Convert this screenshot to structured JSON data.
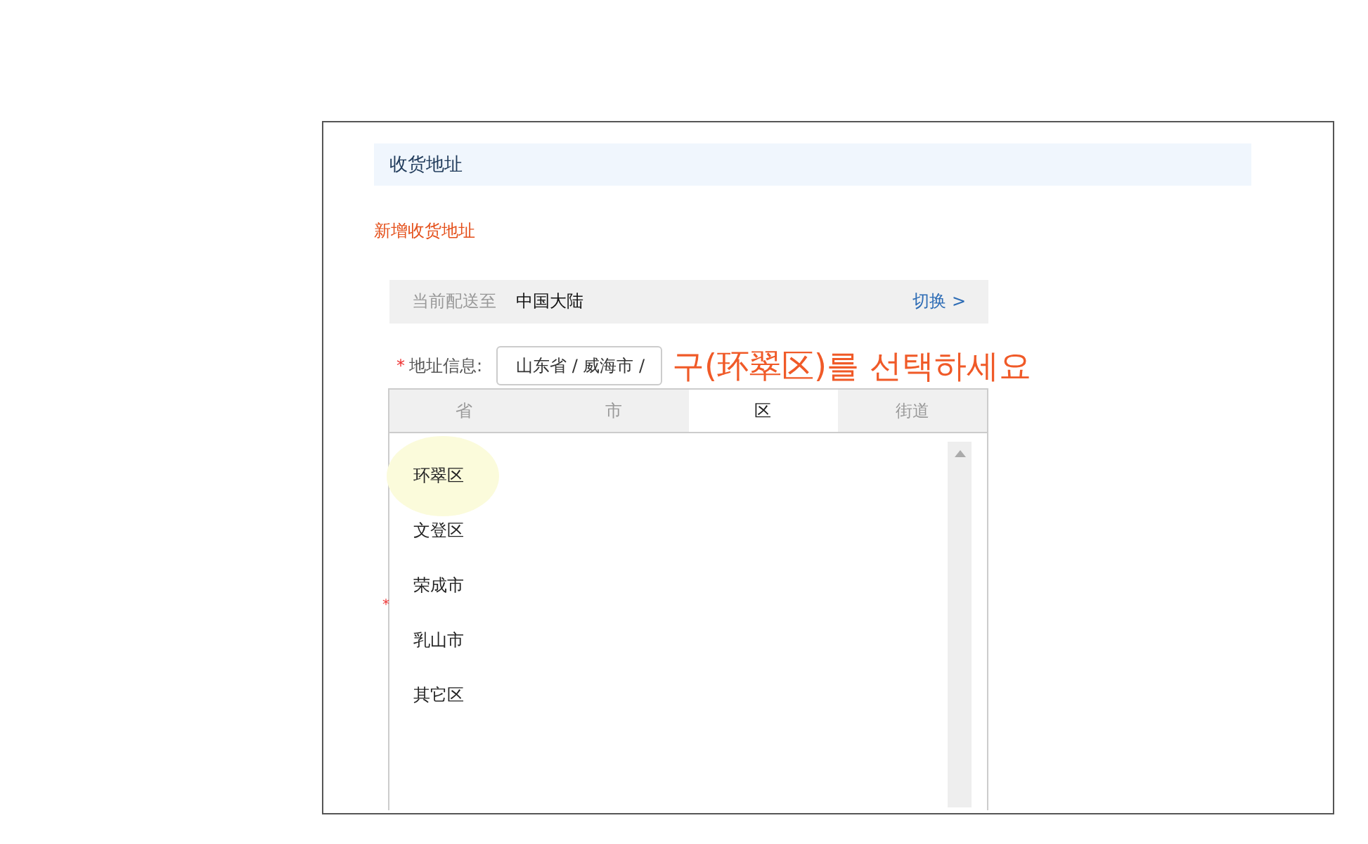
{
  "section_title": "收货地址",
  "add_link": "新增收货地址",
  "delivery": {
    "label": "当前配送至",
    "value": "中国大陆",
    "switch": "切换 >"
  },
  "address": {
    "required": "*",
    "label": "地址信息:",
    "value": "山东省 / 威海市 /"
  },
  "tabs": [
    {
      "label": "省",
      "selected": false
    },
    {
      "label": "市",
      "selected": false
    },
    {
      "label": "区",
      "selected": true
    },
    {
      "label": "街道",
      "selected": false
    }
  ],
  "items": [
    {
      "label": "环翠区",
      "highlighted": true
    },
    {
      "label": "文登区",
      "highlighted": false
    },
    {
      "label": "荣成市",
      "highlighted": false
    },
    {
      "label": "乳山市",
      "highlighted": false
    },
    {
      "label": "其它区",
      "highlighted": false
    }
  ],
  "hidden_required_mark": "*",
  "annotation": "구(环翠区)를 선택하세요"
}
